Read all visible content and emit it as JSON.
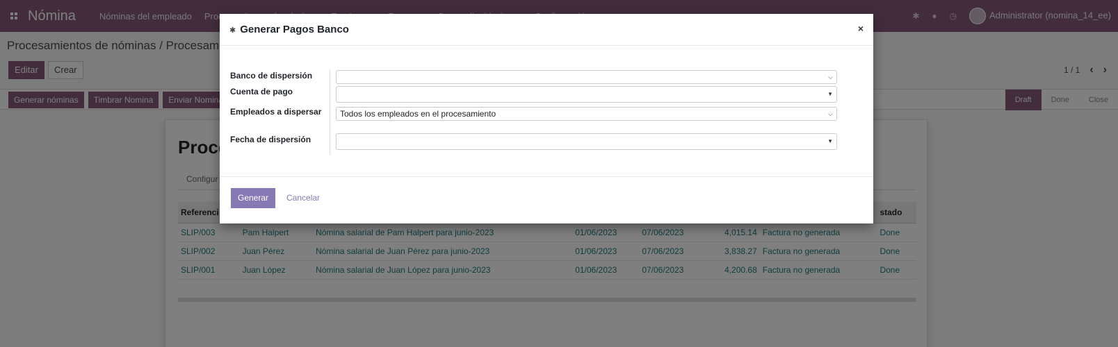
{
  "navbar": {
    "brand": "Nómina",
    "menu": [
      "Nóminas del empleado",
      "Procesamientos de nóminas",
      "Employees",
      "Reportes",
      "Genera liquidaciones",
      "Configuración"
    ],
    "user": "Administrator (nomina_14_ee)"
  },
  "control": {
    "breadcrumb": "Procesamientos de nóminas / Procesamiento",
    "edit_label": "Editar",
    "create_label": "Crear",
    "pager": "1 / 1"
  },
  "statusbar": {
    "buttons": [
      "Generar nóminas",
      "Timbrar Nomina",
      "Enviar Nomina"
    ],
    "states": [
      "Draft",
      "Done",
      "Close"
    ]
  },
  "sheet": {
    "title": "Proce",
    "tab": "Configur",
    "columns": [
      "Referenci",
      "",
      "",
      "",
      "",
      "",
      "",
      "stado"
    ],
    "rows": [
      {
        "ref": "SLIP/003",
        "employee": "Pam Halpert",
        "desc": "Nómina salarial de Pam Halpert para junio-2023",
        "from": "01/06/2023",
        "to": "07/06/2023",
        "amount": "4,015.14",
        "invoice": "Factura no generada",
        "state": "Done"
      },
      {
        "ref": "SLIP/002",
        "employee": "Juan Pérez",
        "desc": "Nómina salarial de Juan Pérez para junio-2023",
        "from": "01/06/2023",
        "to": "07/06/2023",
        "amount": "3,838.27",
        "invoice": "Factura no generada",
        "state": "Done"
      },
      {
        "ref": "SLIP/001",
        "employee": "Juan López",
        "desc": "Nómina salarial de Juan López para junio-2023",
        "from": "01/06/2023",
        "to": "07/06/2023",
        "amount": "4,200.68",
        "invoice": "Factura no generada",
        "state": "Done"
      }
    ]
  },
  "modal": {
    "title": "Generar Pagos Banco",
    "close": "×",
    "fields": {
      "bank_label": "Banco de dispersión",
      "bank_value": "",
      "account_label": "Cuenta de pago",
      "account_value": "",
      "employees_label": "Empleados a dispersar",
      "employees_value": "Todos los empleados en el procesamiento",
      "date_label": "Fecha de dispersión",
      "date_value": ""
    },
    "generate_label": "Generar",
    "cancel_label": "Cancelar"
  }
}
